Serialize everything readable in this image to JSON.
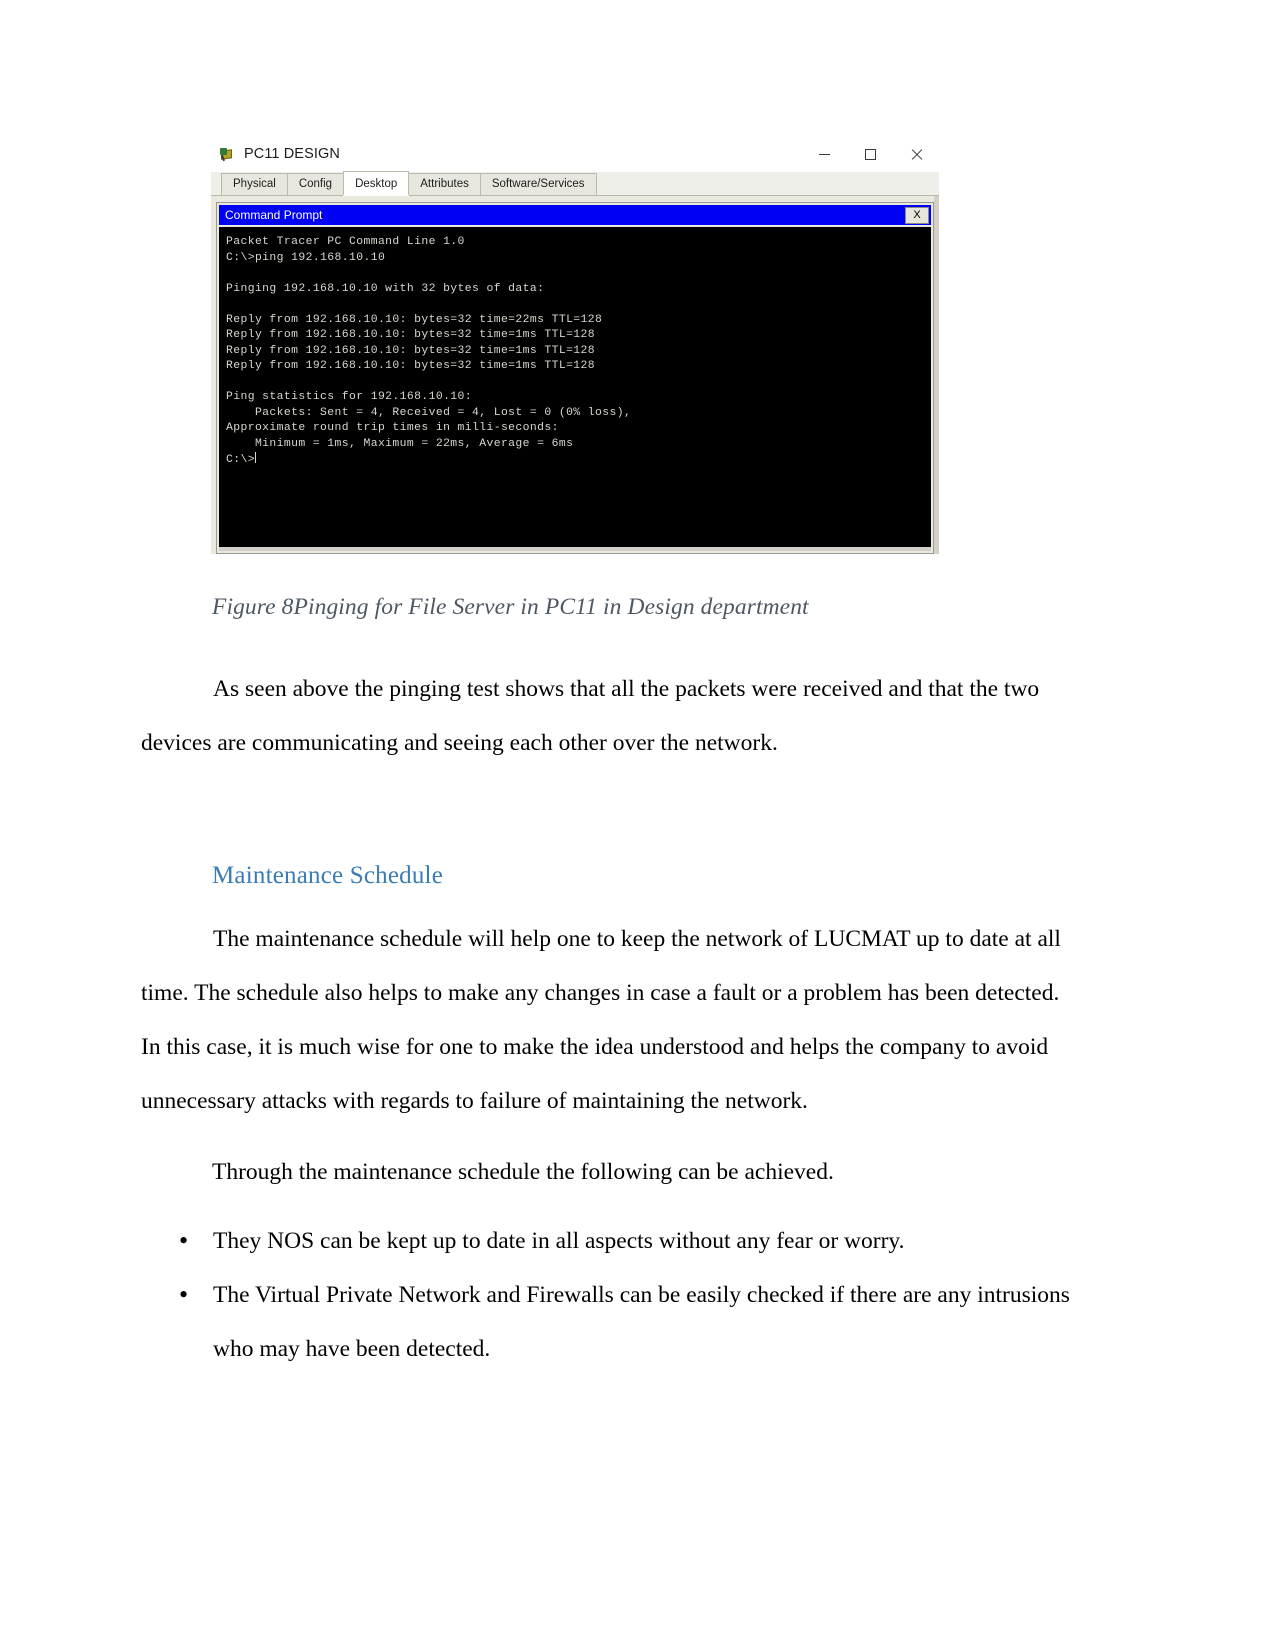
{
  "figure": {
    "window": {
      "title": "PC11 DESIGN",
      "icon": "packet-tracer-pc-icon",
      "controls": {
        "minimize": "minimize-icon",
        "maximize": "maximize-icon",
        "close": "close-icon"
      },
      "tabs": [
        {
          "label": "Physical",
          "active": false
        },
        {
          "label": "Config",
          "active": false
        },
        {
          "label": "Desktop",
          "active": true
        },
        {
          "label": "Attributes",
          "active": false
        },
        {
          "label": "Software/Services",
          "active": false
        }
      ],
      "command_prompt": {
        "title": "Command Prompt",
        "close_label": "X",
        "title_bar_color": "#0000f4",
        "background_color": "#000000",
        "text_color": "#d8d8cf",
        "output": "Packet Tracer PC Command Line 1.0\nC:\\>ping 192.168.10.10\n\nPinging 192.168.10.10 with 32 bytes of data:\n\nReply from 192.168.10.10: bytes=32 time=22ms TTL=128\nReply from 192.168.10.10: bytes=32 time=1ms TTL=128\nReply from 192.168.10.10: bytes=32 time=1ms TTL=128\nReply from 192.168.10.10: bytes=32 time=1ms TTL=128\n\nPing statistics for 192.168.10.10:\n    Packets: Sent = 4, Received = 4, Lost = 0 (0% loss),\nApproximate round trip times in milli-seconds:\n    Minimum = 1ms, Maximum = 22ms, Average = 6ms\n",
        "prompt": "C:\\>"
      }
    },
    "caption": "Figure 8Pinging for File Server in PC11 in Design department"
  },
  "document": {
    "paragraph_1": "As seen above the pinging test shows that all the packets were received and that the two devices are communicating and seeing each other over the network.",
    "heading_1": "Maintenance Schedule",
    "heading_1_color": "#3b7cb5",
    "paragraph_2": "The maintenance schedule will help one to keep the network of LUCMAT up to date at all time. The schedule also helps to make any changes in case a fault or a problem has been detected. In this case, it is much wise for one to make the idea understood and helps the company to avoid unnecessary attacks with regards to failure of maintaining the network.",
    "paragraph_3": "Through the maintenance schedule the following can be achieved.",
    "bullets": [
      "They NOS can be kept up to date in all aspects without any fear or worry.",
      "The Virtual Private Network and Firewalls can be easily checked if there are any intrusions who may have been detected."
    ]
  }
}
